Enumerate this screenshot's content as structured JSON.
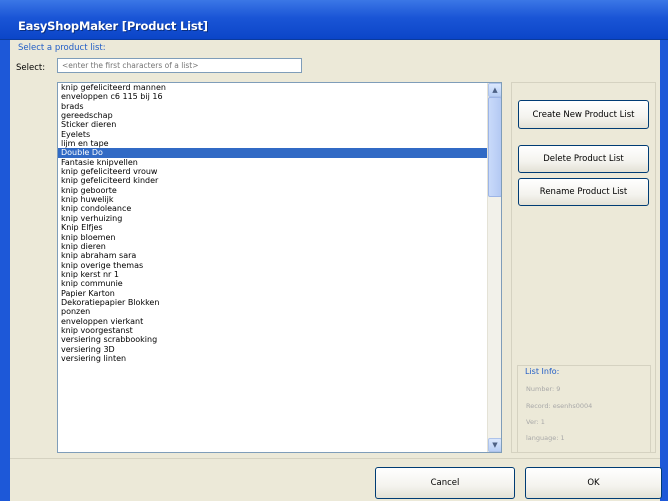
{
  "window": {
    "title": "EasyShopMaker [Product List]"
  },
  "select_section": {
    "label": "Select a product list:",
    "field_label": "Select:",
    "placeholder": "<enter the first characters of a list>"
  },
  "product_lists": [
    "knip gefeliciteerd mannen",
    "enveloppen c6 115 bij 16",
    "brads",
    "gereedschap",
    "Sticker dieren",
    "Eyelets",
    "lijm en tape",
    "Double Do",
    "Fantasie knipvellen",
    "knip gefeliciteerd vrouw",
    "knip gefeliciteerd kinder",
    "knip geboorte",
    "knip huwelijk",
    "knip condoleance",
    "knip verhuizing",
    "Knip Elfjes",
    "knip bloemen",
    "knip dieren",
    "knip abraham sara",
    "knip overige themas",
    "knip kerst nr 1",
    "knip communie",
    "Papier Karton",
    "Dekoratiepapier Blokken",
    "ponzen",
    "enveloppen vierkant",
    "knip voorgestanst",
    "versiering scrabbooking",
    "versiering 3D",
    "versiering linten"
  ],
  "selected_index": 7,
  "buttons": {
    "create": "Create New Product List",
    "delete": "Delete Product List",
    "rename": "Rename Product List",
    "cancel": "Cancel",
    "ok": "OK"
  },
  "list_info": {
    "title": "List Info:",
    "lines": [
      "Number: 9",
      "Record: esenhs0004",
      "Ver: 1",
      "language: 1"
    ]
  },
  "colors": {
    "title_bar": "#1a55d6",
    "selection": "#316ac5",
    "group_label": "#215dc6"
  }
}
